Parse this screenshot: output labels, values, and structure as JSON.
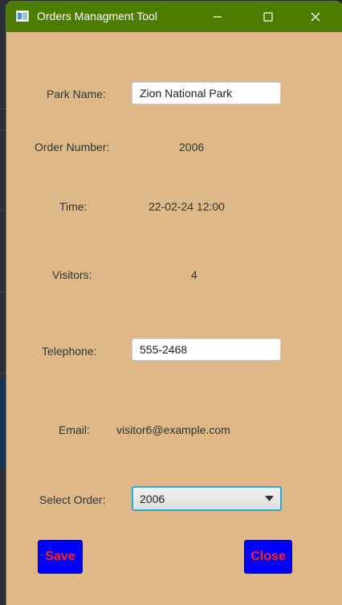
{
  "window": {
    "title": "Orders Managment Tool",
    "titlebar_color": "#4d7d00",
    "background_color": "#deb887",
    "controls": [
      "minimize-icon",
      "maximize-icon",
      "close-icon"
    ]
  },
  "form": {
    "park_name": {
      "label": "Park Name:",
      "value": "Zion National Park"
    },
    "order_number": {
      "label": "Order Number:",
      "value": "2006"
    },
    "time": {
      "label": "Time:",
      "value": "22-02-24 12:00"
    },
    "visitors": {
      "label": "Visitors:",
      "value": "4"
    },
    "telephone": {
      "label": "Telephone:",
      "value": "555-2468"
    },
    "email": {
      "label": "Email:",
      "value": "visitor6@example.com"
    },
    "select_order": {
      "label": "Select Order:",
      "selected": "2006",
      "icon": "chevron-down-icon"
    }
  },
  "buttons": {
    "save_label": "Save",
    "close_label": "Close",
    "button_color": "#0000ff",
    "button_text_color": "#ff2020"
  }
}
